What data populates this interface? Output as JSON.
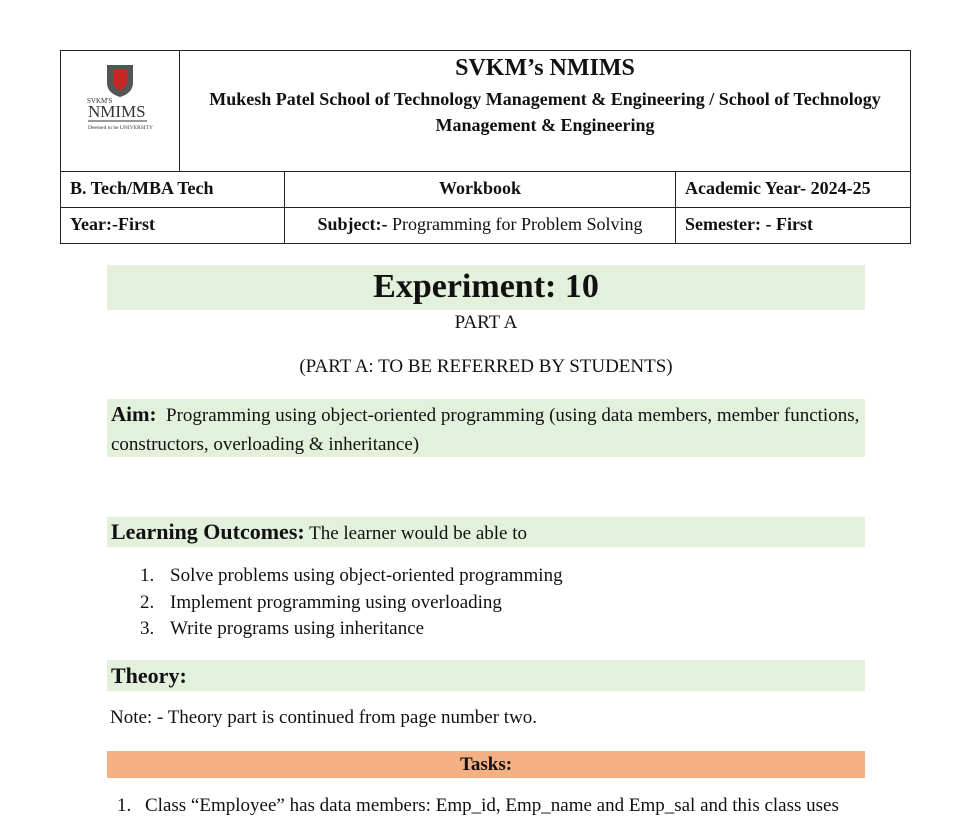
{
  "header": {
    "org_title": "SVKM’s NMIMS",
    "org_sub": "Mukesh Patel School of Technology Management & Engineering / School of Technology Management & Engineering",
    "logo": {
      "small_text": "SVKM'S",
      "main_text": "NMIMS",
      "tagline": "Deemed to be UNIVERSITY",
      "icon": "nmims-shield-logo"
    },
    "program": "B. Tech/MBA Tech",
    "book": "Workbook",
    "academic_year": "Academic Year- 2024-25",
    "year": "Year:-First",
    "subject_label": "Subject:-",
    "subject_value": " Programming for Problem Solving",
    "semester": "Semester: - First"
  },
  "experiment": {
    "title": "Experiment: 10",
    "part": "PART A",
    "part_note": "(PART A: TO BE REFERRED BY STUDENTS)"
  },
  "aim": {
    "label": "Aim:",
    "text": "Programming using object-oriented programming (using data members, member functions, constructors, overloading & inheritance)"
  },
  "learning_outcomes": {
    "label": "Learning Outcomes:",
    "intro": " The learner would be able to",
    "items": [
      {
        "num": "1.",
        "text": "Solve problems using object-oriented programming"
      },
      {
        "num": "2.",
        "text": "Implement programming using overloading"
      },
      {
        "num": "3.",
        "text": "Write programs using inheritance"
      }
    ]
  },
  "theory": {
    "label": "Theory:",
    "note": "Note: - Theory part is continued from page number two."
  },
  "tasks": {
    "label": "Tasks:",
    "first": {
      "num": "1.",
      "text": "Class “Employee” has data members: Emp_id, Emp_name and Emp_sal and this class uses"
    }
  },
  "colors": {
    "green_band": "#e3f0dc",
    "orange_band": "#f4b083"
  }
}
